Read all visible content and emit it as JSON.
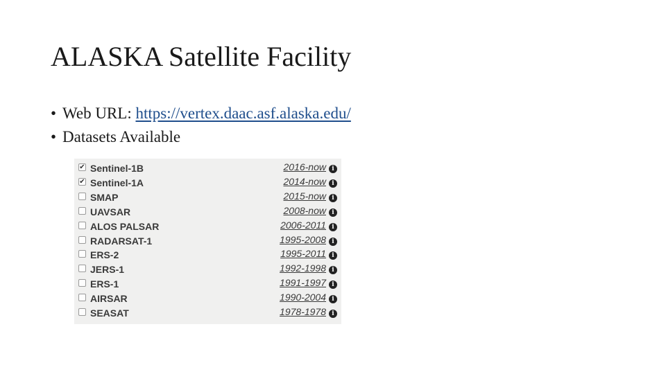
{
  "slide": {
    "title": "ALASKA Satellite Facility",
    "bullets": [
      {
        "label": "Web URL: ",
        "link": "https://vertex.daac.asf.alaska.edu/"
      },
      {
        "label": "Datasets Available"
      }
    ]
  },
  "datasets": [
    {
      "name": "Sentinel-1B",
      "years": "2016-now",
      "checked": true
    },
    {
      "name": "Sentinel-1A",
      "years": "2014-now",
      "checked": true
    },
    {
      "name": "SMAP",
      "years": "2015-now",
      "checked": false
    },
    {
      "name": "UAVSAR",
      "years": "2008-now",
      "checked": false
    },
    {
      "name": "ALOS PALSAR",
      "years": "2006-2011",
      "checked": false
    },
    {
      "name": "RADARSAT-1",
      "years": "1995-2008",
      "checked": false
    },
    {
      "name": "ERS-2",
      "years": "1995-2011",
      "checked": false
    },
    {
      "name": "JERS-1",
      "years": "1992-1998",
      "checked": false
    },
    {
      "name": "ERS-1",
      "years": "1991-1997",
      "checked": false
    },
    {
      "name": "AIRSAR",
      "years": "1990-2004",
      "checked": false
    },
    {
      "name": "SEASAT",
      "years": "1978-1978",
      "checked": false
    }
  ],
  "icons": {
    "checkbox": "checkbox-icon",
    "info": "info-icon"
  },
  "colors": {
    "link": "#1f4e8c",
    "panel_bg": "#f0f0ef"
  }
}
